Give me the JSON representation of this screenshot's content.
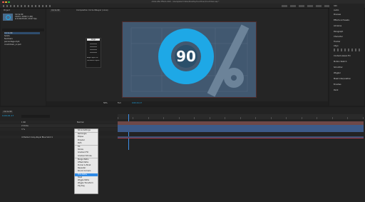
{
  "window": {
    "title": "Adobe After Effects 2020 - /Users/peterchristian/Desktop/Countdown/Countdown.aep *"
  },
  "project_panel": {
    "tab_label": "Project",
    "comp_info": [
      "Circle 90",
      "1920 x 1080 (1.00)",
      "Δ 0;00;05;00, 29.97 fps"
    ],
    "items": [
      "Circle 90",
      "Solids",
      "Numbers",
      "percentage.mp4",
      "countdown_ui.psd"
    ]
  },
  "comp_tabs": [
    "Circle 90",
    "Composition Circle 90",
    "Layer (none)"
  ],
  "comp_viewer": {
    "number": "90",
    "accent": "#1ea8e6",
    "bg": "#415870",
    "zoom": "50%",
    "footer_items": [
      "50%",
      "Full",
      "0;00;01;17"
    ]
  },
  "small_panel": {
    "title": "Align",
    "items": [
      "Align Layers to:",
      "Distribute Layers:"
    ]
  },
  "right_panel": {
    "items": [
      "Info",
      "Audio",
      "Preview",
      "Effects & Presets",
      "Align",
      "Libraries",
      "Paragraph",
      "Character",
      "Tracker",
      "Content-Aware Fill",
      "Motion Sketch",
      "Smoother",
      "Wiggler",
      "Mask Interpolation",
      "Brushes",
      "Paint"
    ],
    "section_label": "Align"
  },
  "timeline": {
    "tab": "Circle 90",
    "timecode": "0;00;01;17",
    "layer_rows": [
      "1  90",
      "2  Circle",
      "3  %",
      "4  Medium Gray-Royal Blue Solid 1"
    ],
    "mode_label": "Normal",
    "ruler_marks": [
      "0:00f",
      "10f",
      "20f",
      "01:00f",
      "10f",
      "20f",
      "02:00f",
      "10f",
      "20f",
      "03:00f",
      "10f",
      "20f",
      "04:00f",
      "10f",
      "20f",
      "05:00f"
    ],
    "bar_colors": [
      "#7a4a4a",
      "#3f5a86",
      "#3f5a86",
      "#7a3a4a"
    ]
  },
  "context_menu": {
    "items": [
      "Show Settings",
      "Rectangle",
      "Ellipse",
      "Polystar",
      "Path",
      "Fill",
      "Stroke",
      "Gradient Fill",
      "Gradient Stroke",
      "Merge Paths",
      "Offset Paths",
      "Pucker & Bloat",
      "Repeater",
      "Round Corners",
      "Trim Paths",
      "Twist",
      "Wiggle Paths",
      "Wiggle Transform",
      "Zig Zag"
    ],
    "selected": "Trim Paths"
  }
}
